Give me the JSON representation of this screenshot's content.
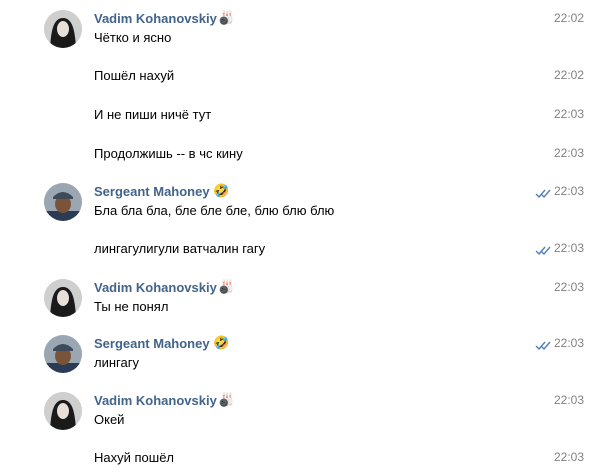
{
  "users": {
    "vadim": "Vadim Kohanovskiy",
    "sergeant": "Sergeant Mahoney"
  },
  "messages": [
    {
      "author": "vadim",
      "text": "Чётко и ясно",
      "time": "22:02",
      "read_check": false
    },
    {
      "author": null,
      "text": "Пошёл нахуй",
      "time": "22:02",
      "read_check": false
    },
    {
      "author": null,
      "text": "И не пиши ничё тут",
      "time": "22:03",
      "read_check": false
    },
    {
      "author": null,
      "text": "Продолжишь -- в чс кину",
      "time": "22:03",
      "read_check": false
    },
    {
      "author": "sergeant",
      "text": "Бла бла бла, бле бле бле, блю блю блю",
      "time": "22:03",
      "read_check": true
    },
    {
      "author": null,
      "text": "лингагулигули ватчалин гагу",
      "time": "22:03",
      "read_check": true
    },
    {
      "author": "vadim",
      "text": "Ты не понял",
      "time": "22:03",
      "read_check": false
    },
    {
      "author": "sergeant",
      "text": "лингагу",
      "time": "22:03",
      "read_check": true
    },
    {
      "author": "vadim",
      "text": "Окей",
      "time": "22:03",
      "read_check": false
    },
    {
      "author": null,
      "text": "Нахуй пошёл",
      "time": "22:03",
      "read_check": false
    }
  ],
  "colors": {
    "author_name": "#42648b",
    "time": "#828282",
    "read_check": "#5181b8"
  }
}
